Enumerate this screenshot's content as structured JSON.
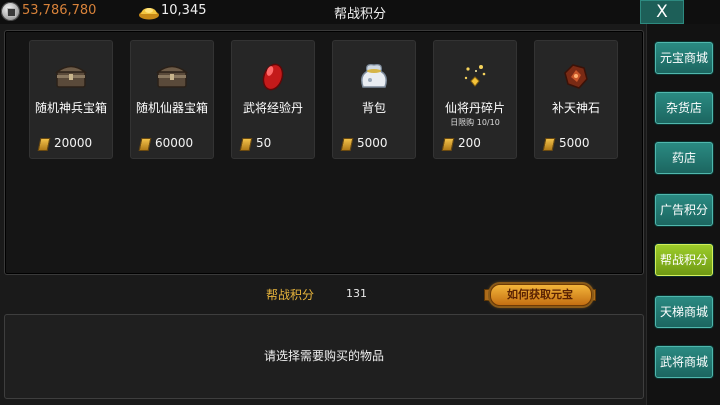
{
  "currency": {
    "copper_value": "53,786,780",
    "gold_value": "10,345",
    "copper_icon": "coin-icon",
    "gold_icon": "gold-ingot-icon"
  },
  "window": {
    "title": "帮战积分",
    "close_label": "X"
  },
  "items": [
    {
      "name": "随机神兵宝箱",
      "price": "20000",
      "limit": "",
      "icon": "chest-icon"
    },
    {
      "name": "随机仙器宝箱",
      "price": "60000",
      "limit": "",
      "icon": "chest-icon"
    },
    {
      "name": "武将经验丹",
      "price": "50",
      "limit": "",
      "icon": "red-pill-icon"
    },
    {
      "name": "背包",
      "price": "5000",
      "limit": "",
      "icon": "bag-icon"
    },
    {
      "name": "仙将丹碎片",
      "price": "200",
      "limit": "日限购 10/10",
      "icon": "sparkle-fragment-icon"
    },
    {
      "name": "补天神石",
      "price": "5000",
      "limit": "",
      "icon": "red-stone-icon"
    }
  ],
  "points": {
    "label": "帮战积分",
    "value": "131"
  },
  "how_button": {
    "label": "如何获取元宝"
  },
  "description": {
    "text": "请选择需要购买的物品"
  },
  "tabs": [
    {
      "label": "元宝商城",
      "active": false
    },
    {
      "label": "杂货店",
      "active": false
    },
    {
      "label": "药店",
      "active": false
    },
    {
      "label": "广告积分",
      "active": false
    },
    {
      "label": "帮战积分",
      "active": true
    },
    {
      "label": "天梯商城",
      "active": false
    },
    {
      "label": "武将商城",
      "active": false
    }
  ],
  "colors": {
    "tab_teal": "#1d6f68",
    "tab_active_green": "#8fbf20",
    "accent_orange": "#e7b43c",
    "copper_text": "#d8823a"
  }
}
